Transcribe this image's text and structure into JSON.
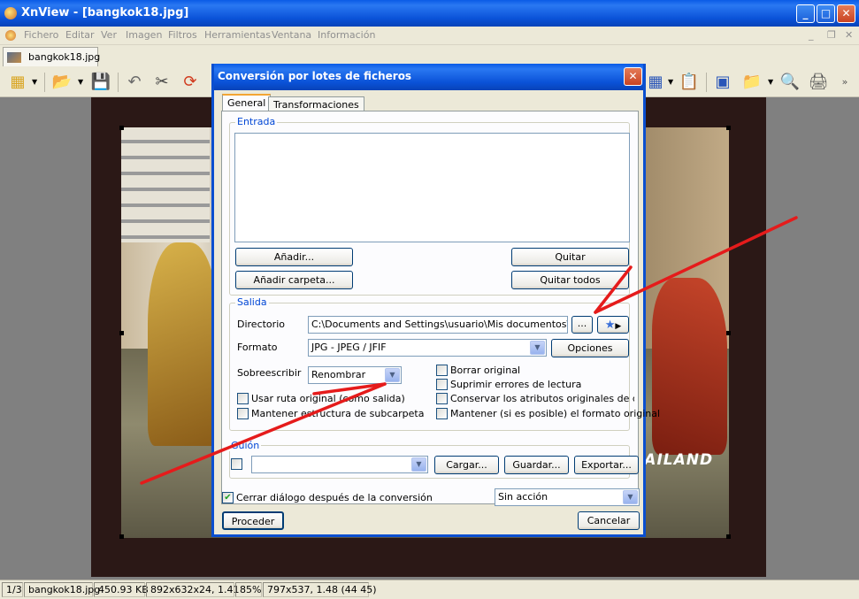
{
  "window": {
    "title": "XnView - [bangkok18.jpg]",
    "min": "_",
    "max": "□",
    "close": "✕"
  },
  "menu": [
    "Fichero",
    "Editar",
    "Ver",
    "Imagen",
    "Filtros",
    "Herramientas",
    "Ventana",
    "Información"
  ],
  "mdi": {
    "min": "_",
    "restore": "❐",
    "close": "✕"
  },
  "doc_tab": "bangkok18.jpg",
  "photo_caption": "BANGKOK-THAILAND",
  "status": [
    "1/3",
    "bangkok18.jpg",
    "450.93 KB",
    "892x632x24, 1.41",
    "85%",
    "797x537, 1.48 (44 45)"
  ],
  "dialog": {
    "title": "Conversión por lotes de ficheros",
    "close": "✕",
    "tabs": [
      "General",
      "Transformaciones"
    ],
    "entrada": {
      "label": "Entrada",
      "add": "Añadir...",
      "remove": "Quitar",
      "add_folder": "Añadir carpeta...",
      "remove_all": "Quitar todos"
    },
    "salida": {
      "label": "Salida",
      "dir_label": "Directorio",
      "dir_value": "C:\\Documents and Settings\\usuario\\Mis documentos\\Mis im",
      "browse": "...",
      "format_label": "Formato",
      "format_value": "JPG - JPEG / JFIF",
      "options": "Opciones",
      "overwrite_label": "Sobreescribir",
      "overwrite_value": "Renombrar",
      "use_original": "Usar ruta original (como salida)",
      "keep_struct": "Mantener estructura de subcarpeta",
      "delete_original": "Borrar original",
      "suppress_errors": "Suprimir errores de lectura",
      "keep_attrs": "Conservar los atributos originales de datos/fe",
      "keep_format": "Mantener (si es posible) el formato original"
    },
    "guion": {
      "label": "Guión",
      "load": "Cargar...",
      "save": "Guardar...",
      "export": "Exportar..."
    },
    "close_after": "Cerrar diálogo después de la conversión",
    "action": "Sin acción",
    "proceed": "Proceder",
    "cancel": "Cancelar"
  },
  "colors": {
    "xp_blue": "#0a52d8",
    "annotation": "#e51b1b"
  }
}
